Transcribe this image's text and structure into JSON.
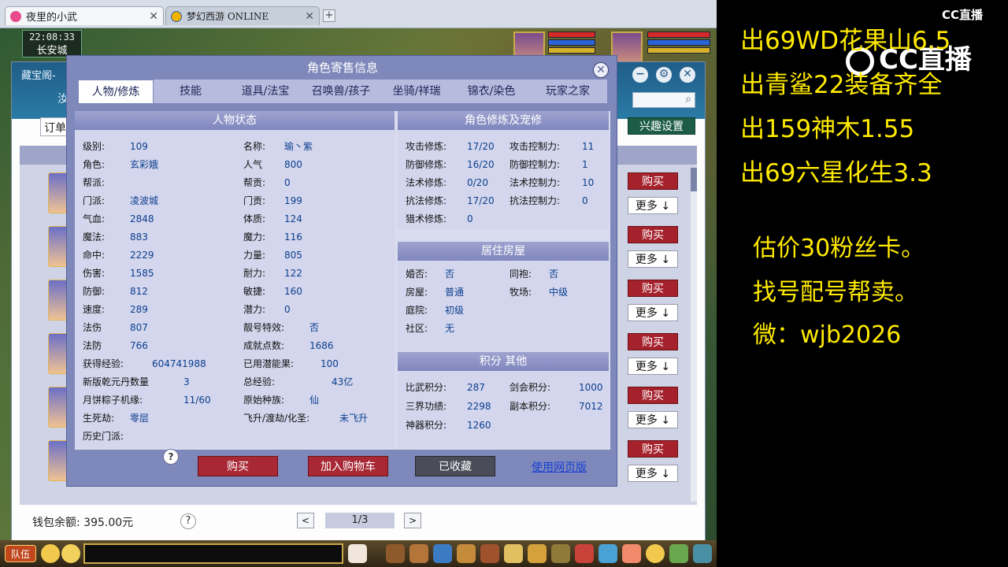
{
  "browser": {
    "tabs": [
      {
        "title": "夜里的小武",
        "active": true
      },
      {
        "title": "梦幻西游 ONLINE",
        "active": false
      }
    ],
    "close_glyph": "✕",
    "newtab_glyph": "+"
  },
  "game": {
    "clock": "22:08:33",
    "city": "长安城"
  },
  "cbg": {
    "title": "藏宝阁-",
    "tab_marker": "汝",
    "search_icon": "search-icon",
    "order_label": "订单",
    "interest_button": "兴趣设置",
    "buy_label": "购买",
    "more_label": "更多 ↓",
    "wallet": "钱包余额: 395.00元",
    "help_glyph": "?",
    "page": "1/3",
    "prev_glyph": "<",
    "next_glyph": ">",
    "controls": [
      "−",
      "⚙",
      "✕"
    ]
  },
  "dialog": {
    "title": "角色寄售信息",
    "close_glyph": "✕",
    "tabs": [
      "人物/修炼",
      "技能",
      "道具/法宝",
      "召唤兽/孩子",
      "坐骑/祥瑞",
      "锦衣/染色",
      "玩家之家"
    ],
    "active_tab": 0,
    "status": {
      "header": "人物状态",
      "left": [
        {
          "k": "级别:",
          "v": "109"
        },
        {
          "k": "角色:",
          "v": "玄彩娥"
        },
        {
          "k": "帮派:",
          "v": ""
        },
        {
          "k": "门派:",
          "v": "凌波城"
        },
        {
          "k": "气血:",
          "v": "2848"
        },
        {
          "k": "魔法:",
          "v": "883"
        },
        {
          "k": "命中:",
          "v": "2229"
        },
        {
          "k": "伤害:",
          "v": "1585"
        },
        {
          "k": "防御:",
          "v": "812"
        },
        {
          "k": "速度:",
          "v": "289"
        },
        {
          "k": "法伤",
          "v": "807"
        },
        {
          "k": "法防",
          "v": "766"
        },
        {
          "k": "获得经验:",
          "v": "604741988"
        },
        {
          "k": "新版乾元丹数量",
          "v": "3"
        },
        {
          "k": "月饼粽子机缘:",
          "v": "11/60"
        },
        {
          "k": "生死劫:",
          "v": "零层"
        },
        {
          "k": "历史门派:",
          "v": ""
        }
      ],
      "right": [
        {
          "k": "名称:",
          "v": "瑜丶紫"
        },
        {
          "k": "人气",
          "v": "800"
        },
        {
          "k": "帮贡:",
          "v": "0"
        },
        {
          "k": "门贡:",
          "v": "199"
        },
        {
          "k": "体质:",
          "v": "124"
        },
        {
          "k": "魔力:",
          "v": "116"
        },
        {
          "k": "力量:",
          "v": "805"
        },
        {
          "k": "耐力:",
          "v": "122"
        },
        {
          "k": "敏捷:",
          "v": "160"
        },
        {
          "k": "潜力:",
          "v": "0"
        },
        {
          "k": "靓号特效:",
          "v": "否"
        },
        {
          "k": "成就点数:",
          "v": "1686"
        },
        {
          "k": "已用潜能果:",
          "v": "100"
        },
        {
          "k": "总经验:",
          "v": "43亿"
        },
        {
          "k": "原始种族:",
          "v": "仙"
        },
        {
          "k": "飞升/渡劫/化圣:",
          "v": "未飞升"
        }
      ]
    },
    "cultivation": {
      "header": "角色修炼及宠修",
      "left": [
        {
          "k": "攻击修炼:",
          "v": "17/20"
        },
        {
          "k": "防御修炼:",
          "v": "16/20"
        },
        {
          "k": "法术修炼:",
          "v": "0/20"
        },
        {
          "k": "抗法修炼:",
          "v": "17/20"
        },
        {
          "k": "猎术修炼:",
          "v": "0"
        }
      ],
      "right": [
        {
          "k": "攻击控制力:",
          "v": "11"
        },
        {
          "k": "防御控制力:",
          "v": "1"
        },
        {
          "k": "法术控制力:",
          "v": "10"
        },
        {
          "k": "抗法控制力:",
          "v": "0"
        }
      ]
    },
    "house": {
      "header": "居住房屋",
      "left": [
        {
          "k": "婚否:",
          "v": "否"
        },
        {
          "k": "房屋:",
          "v": "普通"
        },
        {
          "k": "庭院:",
          "v": "初级"
        },
        {
          "k": "社区:",
          "v": "无"
        }
      ],
      "right": [
        {
          "k": "同袍:",
          "v": "否"
        },
        {
          "k": "牧场:",
          "v": "中级"
        }
      ]
    },
    "points": {
      "header": "积分 其他",
      "left": [
        {
          "k": "比武积分:",
          "v": "287"
        },
        {
          "k": "三界功绩:",
          "v": "2298"
        },
        {
          "k": "神器积分:",
          "v": "1260"
        }
      ],
      "right": [
        {
          "k": "剑会积分:",
          "v": "1000"
        },
        {
          "k": "副本积分:",
          "v": "7012"
        }
      ]
    },
    "buttons": {
      "buy": "购买",
      "add_cart": "加入购物车",
      "favorited": "已收藏",
      "web_version": "使用网页版"
    },
    "help_glyph": "?"
  },
  "toolbar": {
    "team": "队伍"
  },
  "overlay": {
    "cc_small": "CC直播",
    "cc_big": "CC直播",
    "lines": [
      "出69WD花果山6.5",
      "出青鲨22装备齐全",
      "出159神木1.55",
      "出69六星化生3.3",
      "估价30粉丝卡。",
      "找号配号帮卖。",
      "微：wjb2026"
    ]
  }
}
